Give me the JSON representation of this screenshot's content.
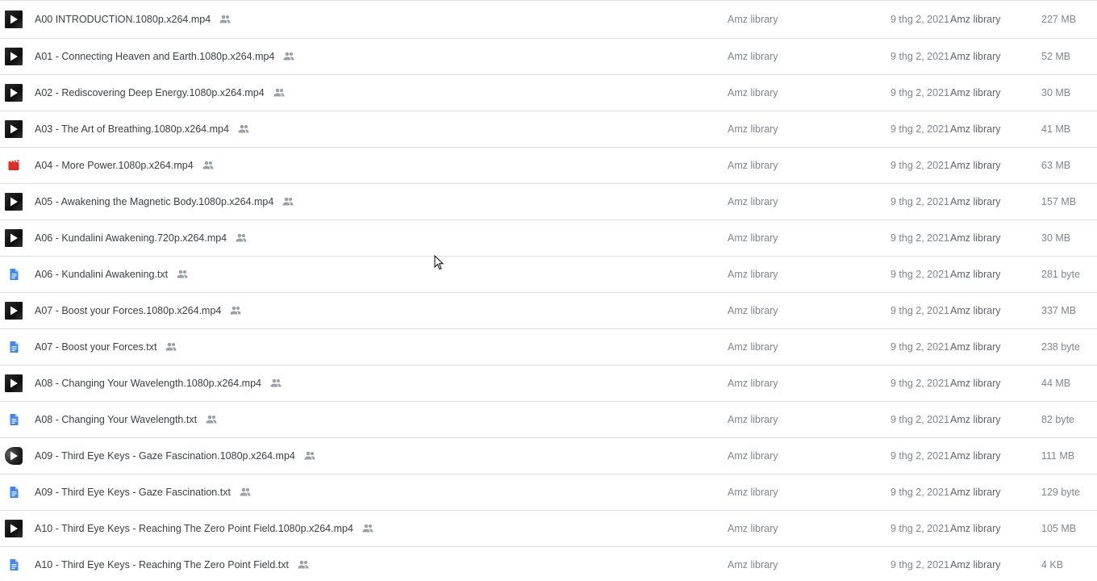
{
  "colors": {
    "doc_blue": "#4285f4",
    "clap_red": "#d93025",
    "divider": "#dadce0",
    "secondary_text": "#80868b"
  },
  "files": [
    {
      "name": "A00 INTRODUCTION.1080p.x264.mp4",
      "icon": "video-thumbnail",
      "owner": "Amz library",
      "modified": "9 thg 2, 2021",
      "modified_by": "Amz library",
      "size": "227 MB"
    },
    {
      "name": "A01 - Connecting Heaven and Earth.1080p.x264.mp4",
      "icon": "video-thumbnail",
      "owner": "Amz library",
      "modified": "9 thg 2, 2021",
      "modified_by": "Amz library",
      "size": "52 MB"
    },
    {
      "name": "A02 - Rediscovering Deep Energy.1080p.x264.mp4",
      "icon": "video-thumbnail",
      "owner": "Amz library",
      "modified": "9 thg 2, 2021",
      "modified_by": "Amz library",
      "size": "30 MB"
    },
    {
      "name": "A03 - The Art of Breathing.1080p.x264.mp4",
      "icon": "video-thumbnail",
      "owner": "Amz library",
      "modified": "9 thg 2, 2021",
      "modified_by": "Amz library",
      "size": "41 MB"
    },
    {
      "name": "A04 - More Power.1080p.x264.mp4",
      "icon": "video-file-icon",
      "owner": "Amz library",
      "modified": "9 thg 2, 2021",
      "modified_by": "Amz library",
      "size": "63 MB"
    },
    {
      "name": "A05 - Awakening the Magnetic Body.1080p.x264.mp4",
      "icon": "video-thumbnail",
      "owner": "Amz library",
      "modified": "9 thg 2, 2021",
      "modified_by": "Amz library",
      "size": "157 MB"
    },
    {
      "name": "A06 - Kundalini Awakening.720p.x264.mp4",
      "icon": "video-thumbnail",
      "owner": "Amz library",
      "modified": "9 thg 2, 2021",
      "modified_by": "Amz library",
      "size": "30 MB"
    },
    {
      "name": "A06 - Kundalini Awakening.txt",
      "icon": "document-icon",
      "owner": "Amz library",
      "modified": "9 thg 2, 2021",
      "modified_by": "Amz library",
      "size": "281 byte"
    },
    {
      "name": "A07 - Boost your Forces.1080p.x264.mp4",
      "icon": "video-thumbnail",
      "owner": "Amz library",
      "modified": "9 thg 2, 2021",
      "modified_by": "Amz library",
      "size": "337 MB"
    },
    {
      "name": "A07 - Boost your Forces.txt",
      "icon": "document-icon",
      "owner": "Amz library",
      "modified": "9 thg 2, 2021",
      "modified_by": "Amz library",
      "size": "238 byte"
    },
    {
      "name": "A08 - Changing Your Wavelength.1080p.x264.mp4",
      "icon": "video-thumbnail",
      "owner": "Amz library",
      "modified": "9 thg 2, 2021",
      "modified_by": "Amz library",
      "size": "44 MB"
    },
    {
      "name": "A08 - Changing Your Wavelength.txt",
      "icon": "document-icon",
      "owner": "Amz library",
      "modified": "9 thg 2, 2021",
      "modified_by": "Amz library",
      "size": "82 byte"
    },
    {
      "name": "A09 - Third Eye Keys - Gaze Fascination.1080p.x264.mp4",
      "icon": "video-thumbnail-round",
      "owner": "Amz library",
      "modified": "9 thg 2, 2021",
      "modified_by": "Amz library",
      "size": "111 MB"
    },
    {
      "name": "A09 - Third Eye Keys - Gaze Fascination.txt",
      "icon": "document-icon",
      "owner": "Amz library",
      "modified": "9 thg 2, 2021",
      "modified_by": "Amz library",
      "size": "129 byte"
    },
    {
      "name": "A10 - Third Eye Keys - Reaching The Zero Point Field.1080p.x264.mp4",
      "icon": "video-thumbnail",
      "owner": "Amz library",
      "modified": "9 thg 2, 2021",
      "modified_by": "Amz library",
      "size": "105 MB"
    },
    {
      "name": "A10 - Third Eye Keys - Reaching The Zero Point Field.txt",
      "icon": "document-icon",
      "owner": "Amz library",
      "modified": "9 thg 2, 2021",
      "modified_by": "Amz library",
      "size": "4 KB"
    }
  ]
}
